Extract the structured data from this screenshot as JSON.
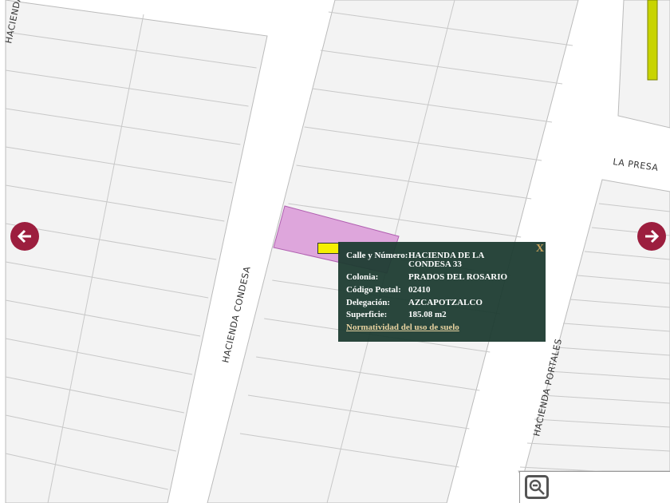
{
  "streets": {
    "hacienda_condesa_top": "HACIENDA",
    "hacienda_condesa": "HACIENDA CONDESA",
    "la_presa": "LA PRESA",
    "hacienda_portales": "HACIENDA PORTALES"
  },
  "popup": {
    "close_label": "X",
    "fields": [
      {
        "label": "Calle y Número:",
        "value": "HACIENDA DE LA CONDESA 33"
      },
      {
        "label": "Colonia:",
        "value": "PRADOS DEL ROSARIO"
      },
      {
        "label": "Código Postal:",
        "value": "02410"
      },
      {
        "label": "Delegación:",
        "value": "AZCAPOTZALCO"
      },
      {
        "label": "Superficie:",
        "value": "185.08 m2"
      }
    ],
    "link": "Normatividad del uso de suelo"
  },
  "colors": {
    "selected_parcel": "#dea6dc",
    "nav": "#9c1e3e",
    "popup_bg": "#1e3c32",
    "highlight_road": "#c8d400"
  }
}
